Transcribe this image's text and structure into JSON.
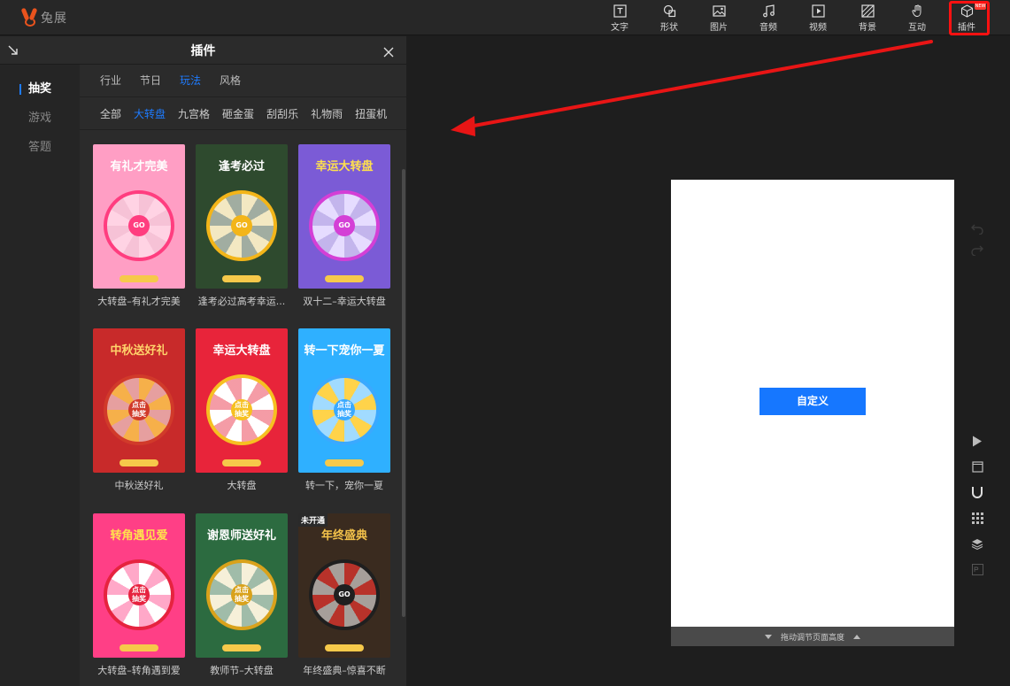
{
  "app": {
    "logo_text": "兔展",
    "brand_color": "#e9531d"
  },
  "toolbar": {
    "items": [
      {
        "label": "文字",
        "icon": "text-icon"
      },
      {
        "label": "形状",
        "icon": "shape-icon"
      },
      {
        "label": "图片",
        "icon": "image-icon"
      },
      {
        "label": "音频",
        "icon": "music-icon"
      },
      {
        "label": "视频",
        "icon": "video-icon"
      },
      {
        "label": "背景",
        "icon": "background-icon"
      },
      {
        "label": "互动",
        "icon": "hand-icon"
      },
      {
        "label": "插件",
        "icon": "plugin-icon"
      }
    ],
    "new_badge": "NEW",
    "highlight_color": "#ff1111"
  },
  "panel": {
    "title": "插件",
    "side_categories": [
      "抽奖",
      "游戏",
      "答题"
    ],
    "tabs": [
      "行业",
      "节日",
      "玩法",
      "风格"
    ],
    "subtabs": [
      "全部",
      "大转盘",
      "九宫格",
      "砸金蛋",
      "刮刮乐",
      "礼物雨",
      "扭蛋机"
    ],
    "accent": "#1e7bff",
    "templates": [
      {
        "caption": "大转盘–有礼才完美",
        "headline": "有礼才完美",
        "hub": "GO",
        "bg": "#ff9ec4",
        "wheel": "#f6c2d6",
        "hub_color": "#ff3d7f",
        "head_color": "#ffffff",
        "badge": ""
      },
      {
        "caption": "逢考必过高考幸运...",
        "headline": "逢考必过",
        "hub": "GO",
        "bg": "#2e4a2e",
        "wheel": "#f3e8c2",
        "hub_color": "#f3b519",
        "head_color": "#ffffff",
        "badge": ""
      },
      {
        "caption": "双十二–幸运大转盘",
        "headline": "幸运大转盘",
        "hub": "GO",
        "bg": "#7b5bd6",
        "wheel": "#e6dcff",
        "hub_color": "#d43fd6",
        "head_color": "#ffe14d",
        "badge": ""
      },
      {
        "caption": "中秋送好礼",
        "headline": "中秋送好礼",
        "hub": "点击\n抽奖",
        "bg": "#c82a2a",
        "wheel": "#f6b04a",
        "hub_color": "#d13a2a",
        "head_color": "#ffd36b",
        "badge": ""
      },
      {
        "caption": "大转盘",
        "headline": "幸运大转盘",
        "hub": "点击\n抽奖",
        "bg": "#e8243a",
        "wheel": "#ffffff",
        "hub_color": "#f6c021",
        "head_color": "#ffffff",
        "badge": ""
      },
      {
        "caption": "转一下，宠你一夏",
        "headline": "转一下宠你一夏",
        "hub": "点击\n抽奖",
        "bg": "#2fb0ff",
        "wheel": "#ffd34a",
        "hub_color": "#3aa9ff",
        "head_color": "#ffffff",
        "badge": ""
      },
      {
        "caption": "大转盘–转角遇到爱",
        "headline": "转角遇见爱",
        "hub": "点击\n抽奖",
        "bg": "#ff3f86",
        "wheel": "#ffffff",
        "hub_color": "#e6233f",
        "head_color": "#ffe14d",
        "badge": ""
      },
      {
        "caption": "教师节–大转盘",
        "headline": "谢恩师送好礼",
        "hub": "点击\n抽奖",
        "bg": "#2c6b40",
        "wheel": "#f6f0d9",
        "hub_color": "#d9a21b",
        "head_color": "#ffffff",
        "badge": ""
      },
      {
        "caption": "年终盛典–惊喜不断",
        "headline": "年终盛典",
        "hub": "GO",
        "bg": "#3a2b1f",
        "wheel": "#b8322a",
        "hub_color": "#1f1f1f",
        "head_color": "#f3c24a",
        "badge": "未开通"
      }
    ]
  },
  "canvas": {
    "button_label": "自定义",
    "button_color": "#1677ff",
    "resize_hint": "拖动调节页面高度"
  },
  "side_tools": {
    "top": [
      "undo-icon",
      "redo-icon"
    ],
    "bottom": [
      "play-icon",
      "page-icon",
      "magnet-icon",
      "grid-icon",
      "layers-icon",
      "ps-icon"
    ]
  },
  "annotation_arrow_color": "#e81515"
}
